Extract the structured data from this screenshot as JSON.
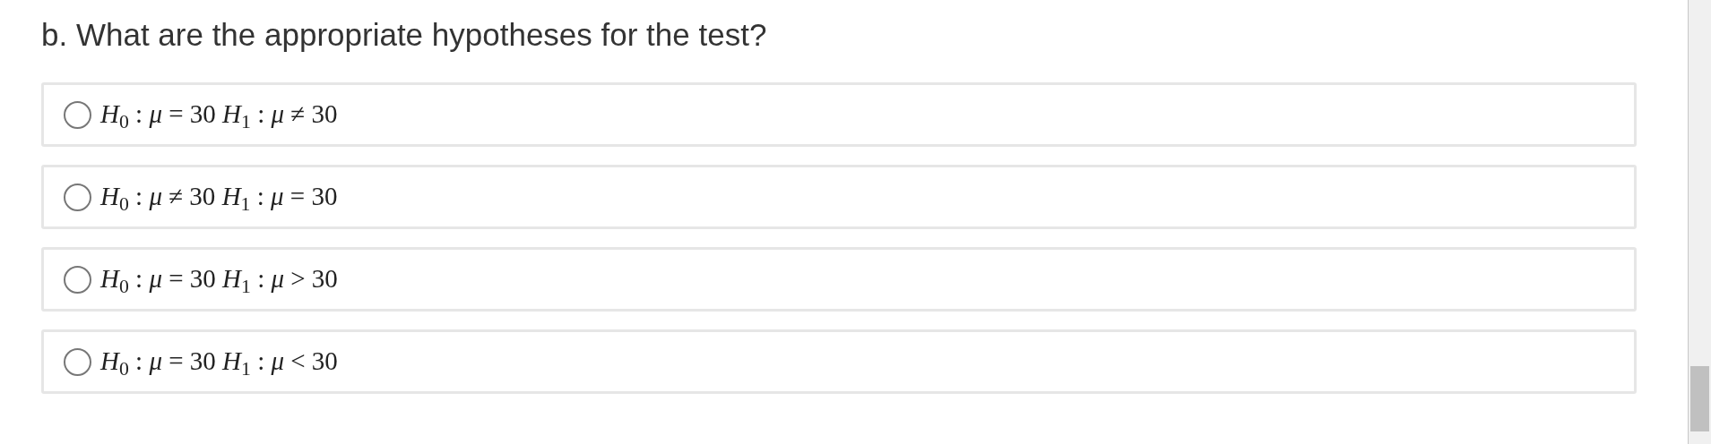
{
  "question": "b. What are the appropriate hypotheses for the test?",
  "options": [
    {
      "label": "*H*$_{0}$ : *μ* = 30 *H*$_{1}$ : *μ* ≠ 30",
      "selected": false
    },
    {
      "label": "*H*$_{0}$ : *μ* ≠ 30 *H*$_{1}$ : *μ* = 30",
      "selected": false
    },
    {
      "label": "*H*$_{0}$ : *μ* = 30 *H*$_{1}$ : *μ* > 30",
      "selected": false
    },
    {
      "label": "*H*$_{0}$ : *μ* = 30 *H*$_{1}$ : *μ* < 30",
      "selected": false
    }
  ]
}
